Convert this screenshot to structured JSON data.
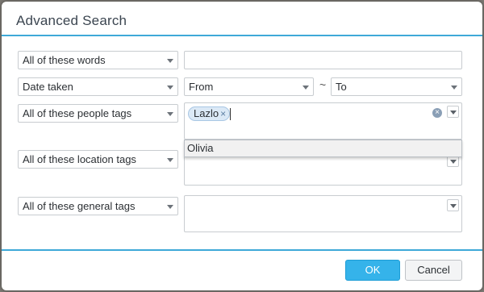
{
  "dialog": {
    "title": "Advanced Search"
  },
  "rows": {
    "words": {
      "match_label": "All of these words",
      "value": ""
    },
    "date": {
      "field_label": "Date taken",
      "from_label": "From",
      "separator": "~",
      "to_label": "To"
    },
    "people": {
      "match_label": "All of these people tags",
      "chips": [
        "Lazlo"
      ],
      "chip_remove_glyph": "×",
      "clear_glyph": "×"
    },
    "location": {
      "match_label": "All of these location tags"
    },
    "general": {
      "match_label": "All of these general tags"
    }
  },
  "suggestions": [
    "Olivia"
  ],
  "buttons": {
    "ok": "OK",
    "cancel": "Cancel"
  },
  "colors": {
    "accent": "#3ea9d8",
    "primary_button": "#35b3ea",
    "chip_bg": "#dbe9f6"
  }
}
